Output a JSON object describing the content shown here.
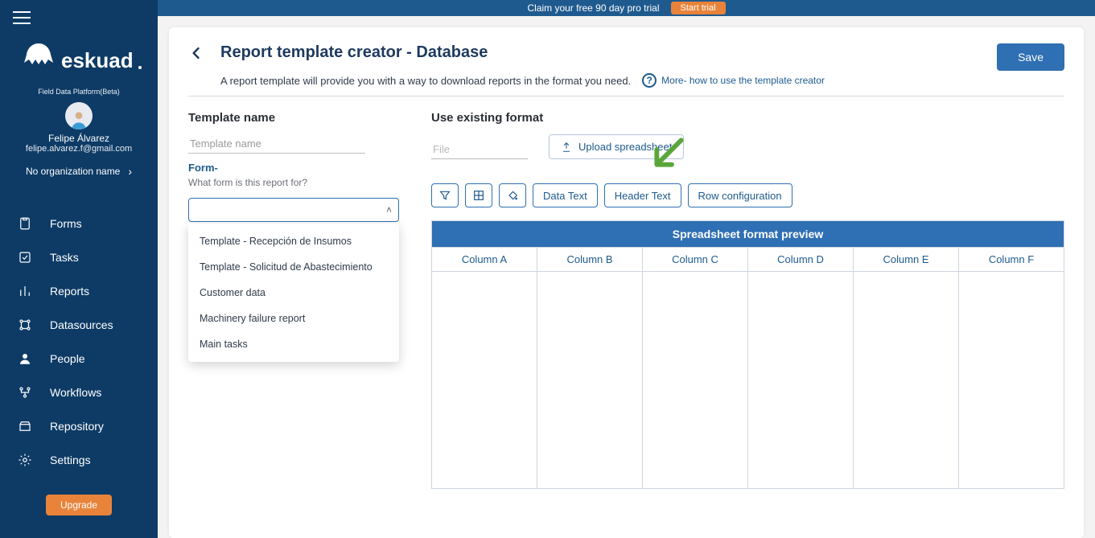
{
  "topbar": {
    "promo": "Claim your free 90 day pro trial",
    "start": "Start trial"
  },
  "brand": {
    "name": "eskuad",
    "tagline": "Field Data Platform(Beta)"
  },
  "user": {
    "name": "Felipe Álvarez",
    "email": "felipe.alvarez.f@gmail.com"
  },
  "org": {
    "name": "No organization name"
  },
  "nav": {
    "forms": "Forms",
    "tasks": "Tasks",
    "reports": "Reports",
    "datasources": "Datasources",
    "people": "People",
    "workflows": "Workflows",
    "repository": "Repository",
    "settings": "Settings",
    "upgrade": "Upgrade"
  },
  "page": {
    "title": "Report template creator - Database",
    "subtitle": "A report template will provide you with a way to download reports in the format you need.",
    "help": "More- how to use the template creator",
    "save": "Save"
  },
  "form": {
    "template_label": "Template name",
    "template_placeholder": "Template name",
    "existing_label": "Use existing format",
    "file_placeholder": "File",
    "upload_btn": "Upload spreadsheet",
    "form_section": "Form-",
    "form_helper": "What form is this report for?",
    "combo_options": [
      "Template - Recepción de Insumos",
      "Template - Solicitud de Abastecimiento",
      "Customer data",
      "Machinery failure report",
      "Main tasks"
    ]
  },
  "toolbar": {
    "data_text": "Data Text",
    "header_text": "Header Text",
    "row_config": "Row configuration"
  },
  "preview": {
    "title": "Spreadsheet format preview",
    "columns": [
      "Column A",
      "Column B",
      "Column C",
      "Column D",
      "Column E",
      "Column F"
    ]
  }
}
